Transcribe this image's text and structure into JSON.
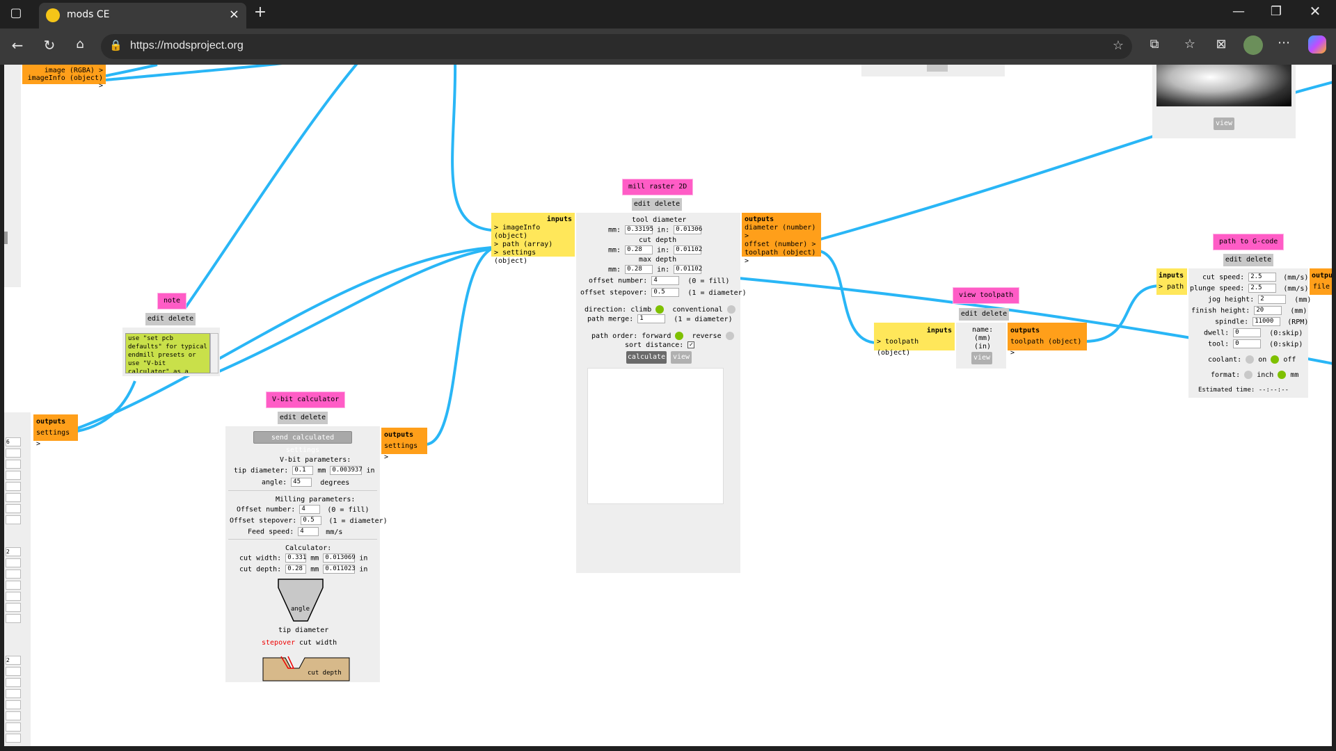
{
  "browser": {
    "tab_title": "mods CE",
    "url": "https://modsproject.org"
  },
  "top_left_module": {
    "outputs": [
      "image (RGBA) >",
      "imageInfo (object) >"
    ]
  },
  "note": {
    "title": "note",
    "buttons": "edit delete",
    "text": "use \"set pcb defaults\" for typical endmill presets or use \"V-bit calculator\" as a"
  },
  "left_outputs": {
    "header": "outputs",
    "item": "settings >"
  },
  "left_column_values": [
    "6",
    "2",
    "2"
  ],
  "vbit": {
    "title": "V-bit calculator",
    "buttons": "edit delete",
    "send_button": "send calculated settings",
    "params_header": "V-bit parameters:",
    "tip_diameter_label": "tip diameter:",
    "tip_diameter_mm": "0.1",
    "tip_diameter_in": "0.003937",
    "unit_mm": "mm",
    "unit_in": "in",
    "angle_label": "angle:",
    "angle_value": "45",
    "angle_unit": "degrees",
    "milling_header": "Milling parameters:",
    "offset_number_label": "Offset number:",
    "offset_number_value": "4",
    "offset_number_note": "(0 = fill)",
    "offset_stepover_label": "Offset stepover:",
    "offset_stepover_value": "0.5",
    "offset_stepover_note": "(1 = diameter)",
    "feed_speed_label": "Feed speed:",
    "feed_speed_value": "4",
    "feed_speed_unit": "mm/s",
    "calc_header": "Calculator:",
    "cut_width_label": "cut width:",
    "cut_width_mm": "0.331",
    "cut_width_in": "0.013069",
    "cut_depth_label": "cut depth:",
    "cut_depth_mm": "0.28",
    "cut_depth_in": "0.011023",
    "diagram_angle": "angle",
    "diagram_tip": "tip diameter",
    "diagram_stepover": "stepover",
    "diagram_cut_width": "cut width",
    "diagram_cut_depth": "cut depth",
    "outputs_header": "outputs",
    "outputs_item": "settings >"
  },
  "mill_raster": {
    "title": "mill raster 2D",
    "buttons": "edit delete",
    "inputs_header": "inputs",
    "inputs": [
      "> imageInfo (object)",
      "> path (array)",
      "> settings (object)"
    ],
    "tool_diameter_label": "tool diameter",
    "mm_label": "mm:",
    "in_label": "in:",
    "tool_diameter_mm": "0.33195",
    "tool_diameter_in": "0.01306",
    "cut_depth_label": "cut depth",
    "cut_depth_mm": "0.28",
    "cut_depth_in": "0.01102",
    "max_depth_label": "max depth",
    "max_depth_mm": "0.28",
    "max_depth_in": "0.01102",
    "offset_number_label": "offset number:",
    "offset_number_value": "4",
    "offset_number_note": "(0 = fill)",
    "offset_stepover_label": "offset stepover:",
    "offset_stepover_value": "0.5",
    "offset_stepover_note": "(1 = diameter)",
    "direction_label": "direction: climb",
    "direction_alt": "conventional",
    "path_merge_label": "path merge:",
    "path_merge_value": "1",
    "path_merge_note": "(1 = diameter)",
    "path_order_label": "path order: forward",
    "path_order_alt": "reverse",
    "sort_distance_label": "sort distance:",
    "calculate_button": "calculate",
    "view_button": "view",
    "outputs_header": "outputs",
    "outputs": [
      "diameter (number) >",
      "offset (number) >",
      "toolpath (object) >"
    ]
  },
  "view_toolpath": {
    "title": "view toolpath",
    "buttons": "edit delete",
    "inputs_header": "inputs",
    "inputs_item": "> toolpath (object)",
    "name_label": "name:",
    "mm_label": "(mm)",
    "in_label": "(in)",
    "view_button": "view",
    "outputs_header": "outputs",
    "outputs_item": "toolpath (object) >"
  },
  "gcode": {
    "title": "path to G-code",
    "buttons": "edit delete",
    "inputs_header": "inputs",
    "inputs_item": "> path",
    "outputs_header": "outpu",
    "outputs_item": "file",
    "cut_speed_label": "cut speed:",
    "cut_speed_value": "2.5",
    "plunge_speed_label": "plunge speed:",
    "plunge_speed_value": "2.5",
    "speed_unit": "(mm/s)",
    "jog_height_label": "jog height:",
    "jog_height_value": "2",
    "finish_height_label": "finish height:",
    "finish_height_value": "20",
    "height_unit": "(mm)",
    "spindle_label": "spindle:",
    "spindle_value": "11000",
    "spindle_unit": "(RPM)",
    "dwell_label": "dwell:",
    "dwell_value": "0",
    "tool_label": "tool:",
    "tool_value": "0",
    "skip_note": "(0:skip)",
    "coolant_label": "coolant:",
    "coolant_on": "on",
    "coolant_off": "off",
    "format_label": "format:",
    "format_inch": "inch",
    "format_mm": "mm",
    "estimated_time": "Estimated time: --:--:--"
  },
  "top_right_view": {
    "view_button": "view"
  },
  "colors": {
    "wire": "#29b6f6",
    "title": "#ff5cc6",
    "inputs": "#ffe75a",
    "outputs": "#ff9f1a",
    "radio_on": "#7ec000"
  }
}
